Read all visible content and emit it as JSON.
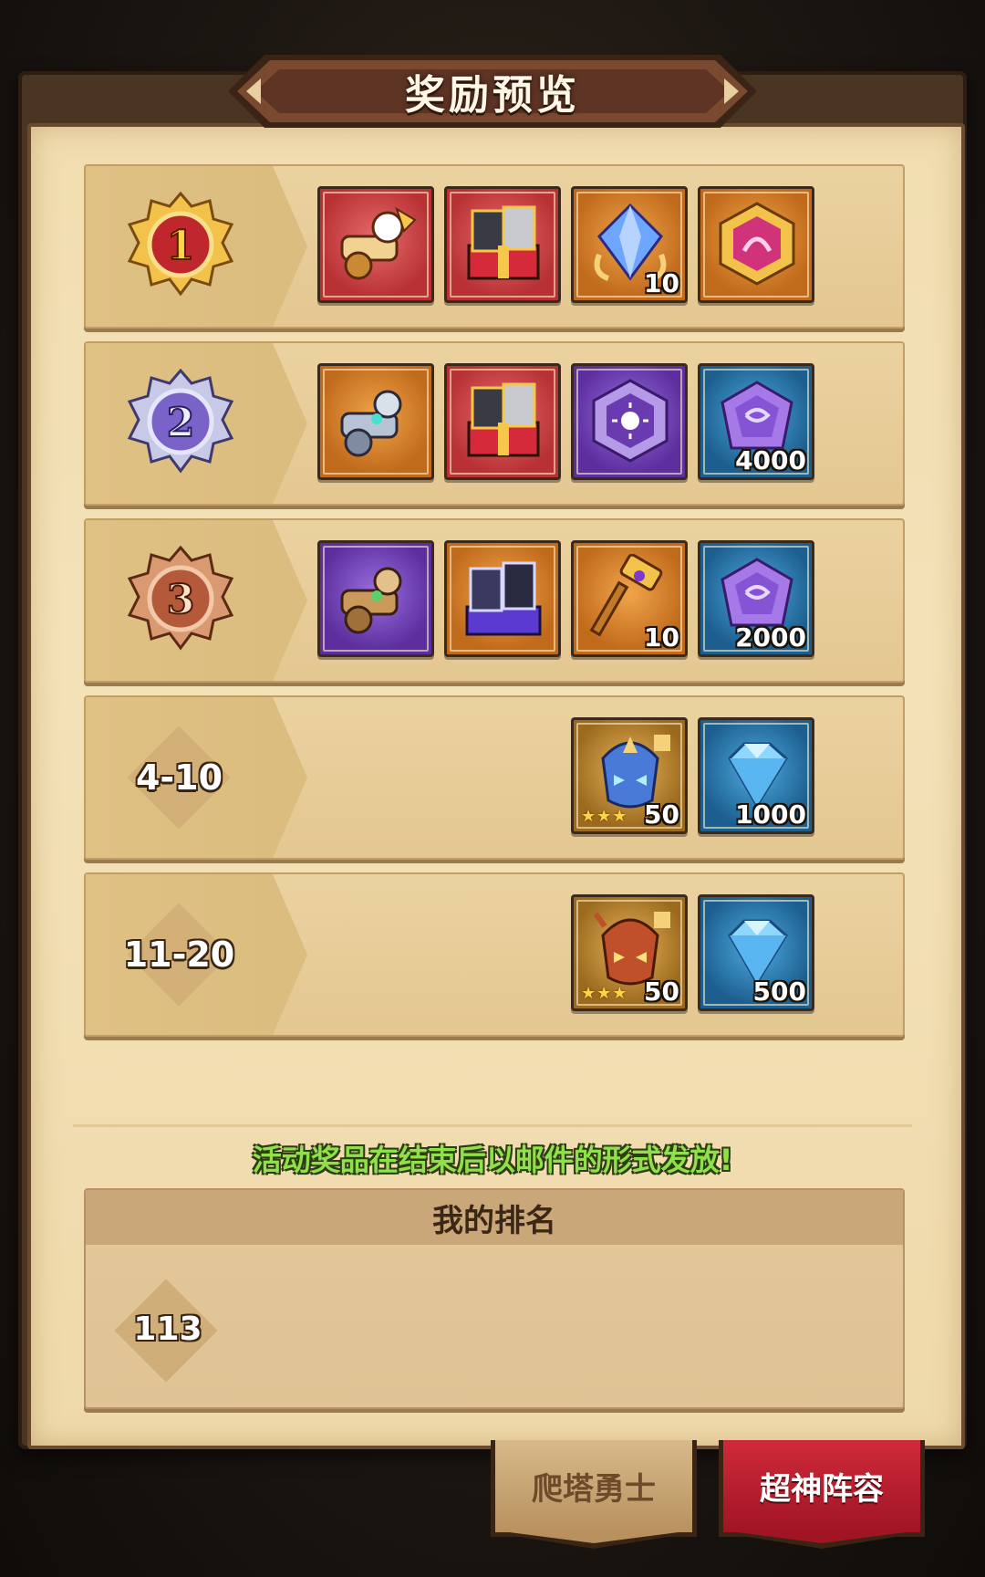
{
  "header": {
    "title": "奖励预览"
  },
  "ranks": [
    {
      "label": "1",
      "badge_color": "#c0272d",
      "items": [
        {
          "icon": "red-cannon-artifact-icon",
          "bg": "red",
          "qty": ""
        },
        {
          "icon": "hero-chest-icon",
          "bg": "red",
          "qty": ""
        },
        {
          "icon": "crystal-icon",
          "bg": "orange",
          "qty": "10"
        },
        {
          "icon": "gold-hex-emblem-icon",
          "bg": "orange",
          "qty": ""
        }
      ]
    },
    {
      "label": "2",
      "badge_color": "#7a63c8",
      "items": [
        {
          "icon": "silver-cannon-artifact-icon",
          "bg": "orange",
          "qty": ""
        },
        {
          "icon": "hero-chest-icon",
          "bg": "red",
          "qty": ""
        },
        {
          "icon": "purple-hex-emblem-icon",
          "bg": "purple",
          "qty": ""
        },
        {
          "icon": "purple-gem-icon",
          "bg": "blue",
          "qty": "4000"
        }
      ]
    },
    {
      "label": "3",
      "badge_color": "#b45a3a",
      "items": [
        {
          "icon": "bronze-cannon-artifact-icon",
          "bg": "purple",
          "qty": ""
        },
        {
          "icon": "hero-card-box-icon",
          "bg": "orange",
          "qty": ""
        },
        {
          "icon": "gold-hammer-icon",
          "bg": "orange",
          "qty": "10"
        },
        {
          "icon": "purple-gem-icon",
          "bg": "blue",
          "qty": "2000"
        }
      ]
    },
    {
      "label": "4-10",
      "items": [
        {
          "icon": "blue-helmet-shard-icon",
          "bg": "gold",
          "qty": "50",
          "stars": "★★★"
        },
        {
          "icon": "diamond-icon",
          "bg": "blue",
          "qty": "1000"
        }
      ]
    },
    {
      "label": "11-20",
      "items": [
        {
          "icon": "red-helmet-shard-icon",
          "bg": "gold",
          "qty": "50",
          "stars": "★★★"
        },
        {
          "icon": "diamond-icon",
          "bg": "blue",
          "qty": "500"
        }
      ]
    }
  ],
  "notice": "活动奖品在结束后以邮件的形式发放!",
  "my_rank": {
    "title": "我的排名",
    "value": "113"
  },
  "tabs": [
    {
      "label": "爬塔勇士",
      "active": false
    },
    {
      "label": "超神阵容",
      "active": true
    }
  ]
}
